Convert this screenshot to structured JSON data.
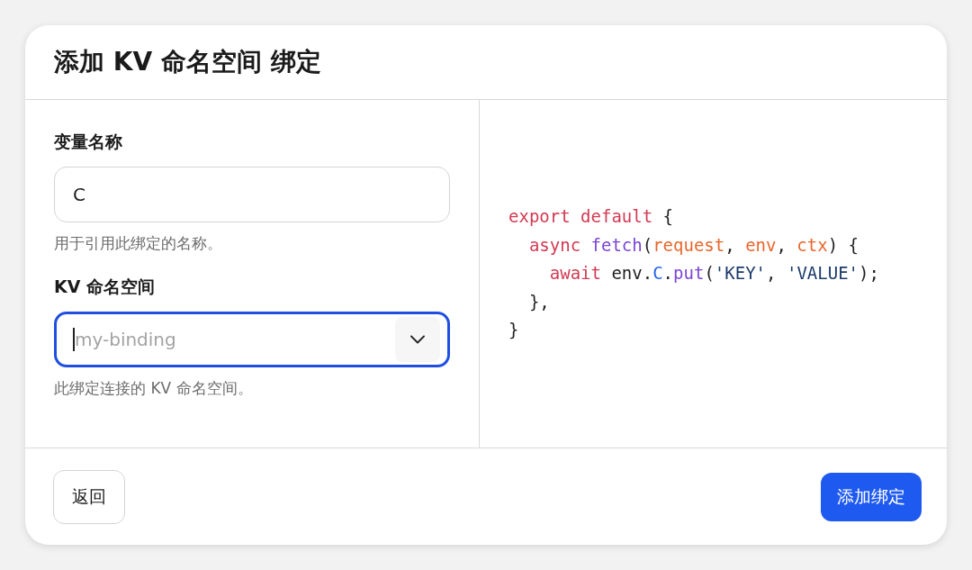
{
  "dialog": {
    "title": "添加 KV 命名空间 绑定"
  },
  "fields": [
    {
      "label": "变量名称",
      "value": "C",
      "focused": false,
      "kind": "text",
      "hint": "用于引用此绑定的名称。"
    },
    {
      "label": "KV 命名空间",
      "placeholder": "my-binding",
      "focused": true,
      "kind": "select",
      "hint": "此绑定连接的 KV 命名空间。"
    }
  ],
  "code": [
    [
      {
        "text": "export default",
        "kind": "keyword"
      },
      {
        "text": " {",
        "kind": "plain"
      }
    ],
    [
      {
        "text": "  async",
        "kind": "keyword"
      },
      {
        "text": " fetch",
        "kind": "function"
      },
      {
        "text": "(",
        "kind": "plain"
      },
      {
        "text": "request",
        "kind": "param"
      },
      {
        "text": ", ",
        "kind": "plain"
      },
      {
        "text": "env",
        "kind": "param"
      },
      {
        "text": ", ",
        "kind": "plain"
      },
      {
        "text": "ctx",
        "kind": "param"
      },
      {
        "text": ") {",
        "kind": "plain"
      }
    ],
    [
      {
        "text": "    await",
        "kind": "keyword"
      },
      {
        "text": " env.",
        "kind": "plain"
      },
      {
        "text": "C",
        "kind": "property"
      },
      {
        "text": ".",
        "kind": "plain"
      },
      {
        "text": "put",
        "kind": "function"
      },
      {
        "text": "(",
        "kind": "plain"
      },
      {
        "text": "'KEY'",
        "kind": "string"
      },
      {
        "text": ", ",
        "kind": "plain"
      },
      {
        "text": "'VALUE'",
        "kind": "string"
      },
      {
        "text": ");",
        "kind": "plain"
      }
    ],
    [
      {
        "text": "  },",
        "kind": "plain"
      }
    ],
    [
      {
        "text": "}",
        "kind": "plain"
      }
    ]
  ],
  "buttons": [
    {
      "label": "返回",
      "kind": "secondary"
    },
    {
      "label": "添加绑定",
      "kind": "primary"
    }
  ]
}
